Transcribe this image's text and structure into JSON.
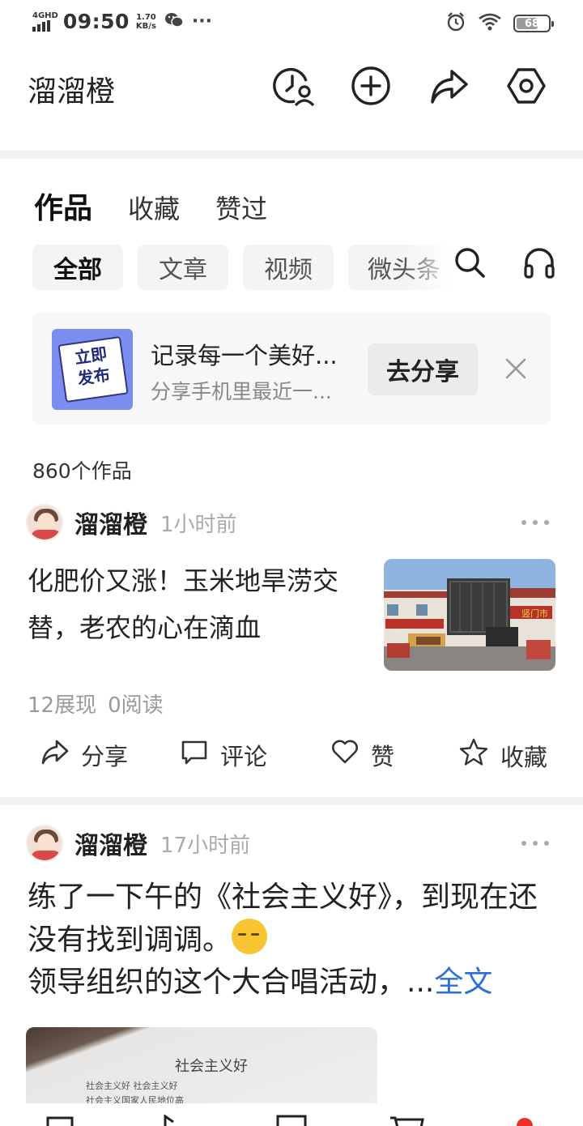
{
  "status_bar": {
    "network": "4GHD",
    "time": "09:50",
    "speed_value": "1.70",
    "speed_unit": "KB/s",
    "more": "···",
    "battery": "68",
    "battery_level": 0.68
  },
  "header": {
    "title": "溜溜橙",
    "icons": [
      "history-user-icon",
      "add-icon",
      "share-icon",
      "settings-icon"
    ]
  },
  "tabs": [
    {
      "label": "作品",
      "active": true
    },
    {
      "label": "收藏",
      "active": false
    },
    {
      "label": "赞过",
      "active": false
    }
  ],
  "filters": [
    {
      "label": "全部",
      "active": true
    },
    {
      "label": "文章",
      "active": false
    },
    {
      "label": "视频",
      "active": false
    },
    {
      "label": "微头条",
      "active": false
    }
  ],
  "banner": {
    "image_text_line1": "立即",
    "image_text_line2": "发布",
    "title": "记录每一个美好...",
    "subtitle": "分享手机里最近一...",
    "button": "去分享"
  },
  "works_count": "860个作品",
  "posts": [
    {
      "author": "溜溜橙",
      "time": "1小时前",
      "text": "化肥价又涨！玉米地旱涝交替，老农的心在滴血",
      "stats_views": "12展现",
      "stats_reads": "0阅读"
    },
    {
      "author": "溜溜橙",
      "time": "17小时前",
      "text_line1": "练了一下午的《社会主义好》，到现在还没有找到调调。",
      "text_line2": "领导组织的这个大合唱活动，...",
      "more_link": "全文",
      "image_title": "社会主义好",
      "image_line1": "社会主义好  社会主义好",
      "image_line2": "社会主义国家人民地位高"
    }
  ],
  "actions": {
    "share": "分享",
    "comment": "评论",
    "like": "赞",
    "favorite": "收藏"
  },
  "store_sign": "竖门市"
}
